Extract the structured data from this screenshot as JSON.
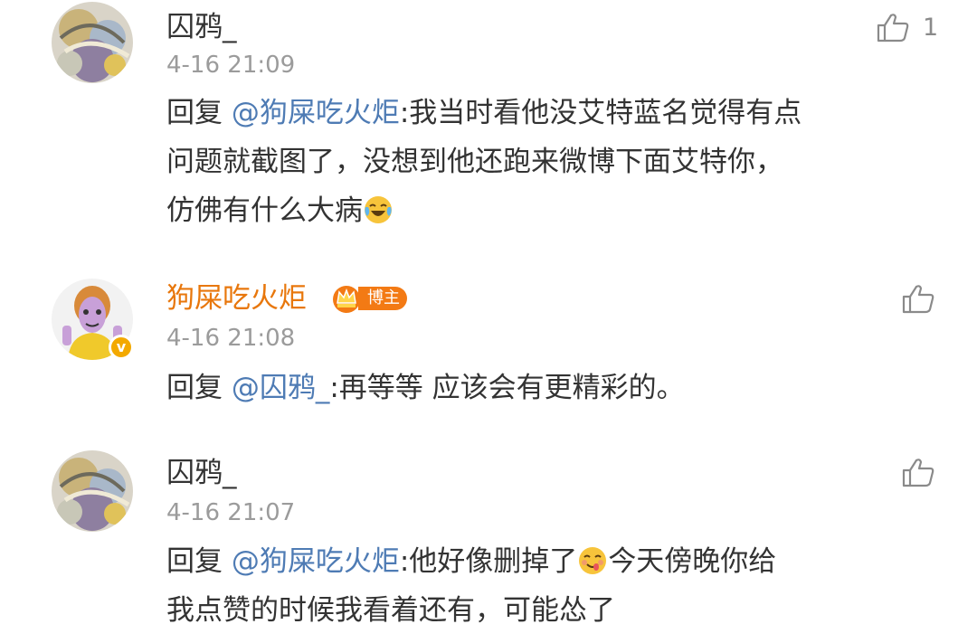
{
  "comments": [
    {
      "username": "囚鸦_",
      "time": "4-16 21:09",
      "like_count": "1",
      "lines": [
        {
          "prefix": "回复 ",
          "mention": "@狗屎吃火炬",
          "text": ":我当时看他没艾特蓝名觉得有点"
        },
        {
          "text": "问题就截图了，没想到他还跑来微博下面艾特你，"
        },
        {
          "text": "仿佛有什么大病"
        }
      ],
      "emoji": "laugh-cry-emoji"
    },
    {
      "username": "狗屎吃火炬",
      "badge": "博主",
      "time": "4-16 21:08",
      "lines": [
        {
          "prefix": "回复 ",
          "mention": "@囚鸦_",
          "text": ":再等等 应该会有更精彩的。"
        }
      ]
    },
    {
      "username": "囚鸦_",
      "time": "4-16 21:07",
      "lines": [
        {
          "prefix": "回复 ",
          "mention": "@狗屎吃火炬",
          "text": ":他好像删掉了"
        },
        {
          "text": "今天傍晚你给"
        },
        {
          "text": "我点赞的时候我看着还有，可能怂了"
        }
      ],
      "emoji": "yummy-emoji"
    }
  ],
  "colors": {
    "mention": "#4e7bb4",
    "owner_name": "#e8770c",
    "badge": "#f37a14",
    "meta": "#9b9b9b",
    "text": "#333333"
  }
}
